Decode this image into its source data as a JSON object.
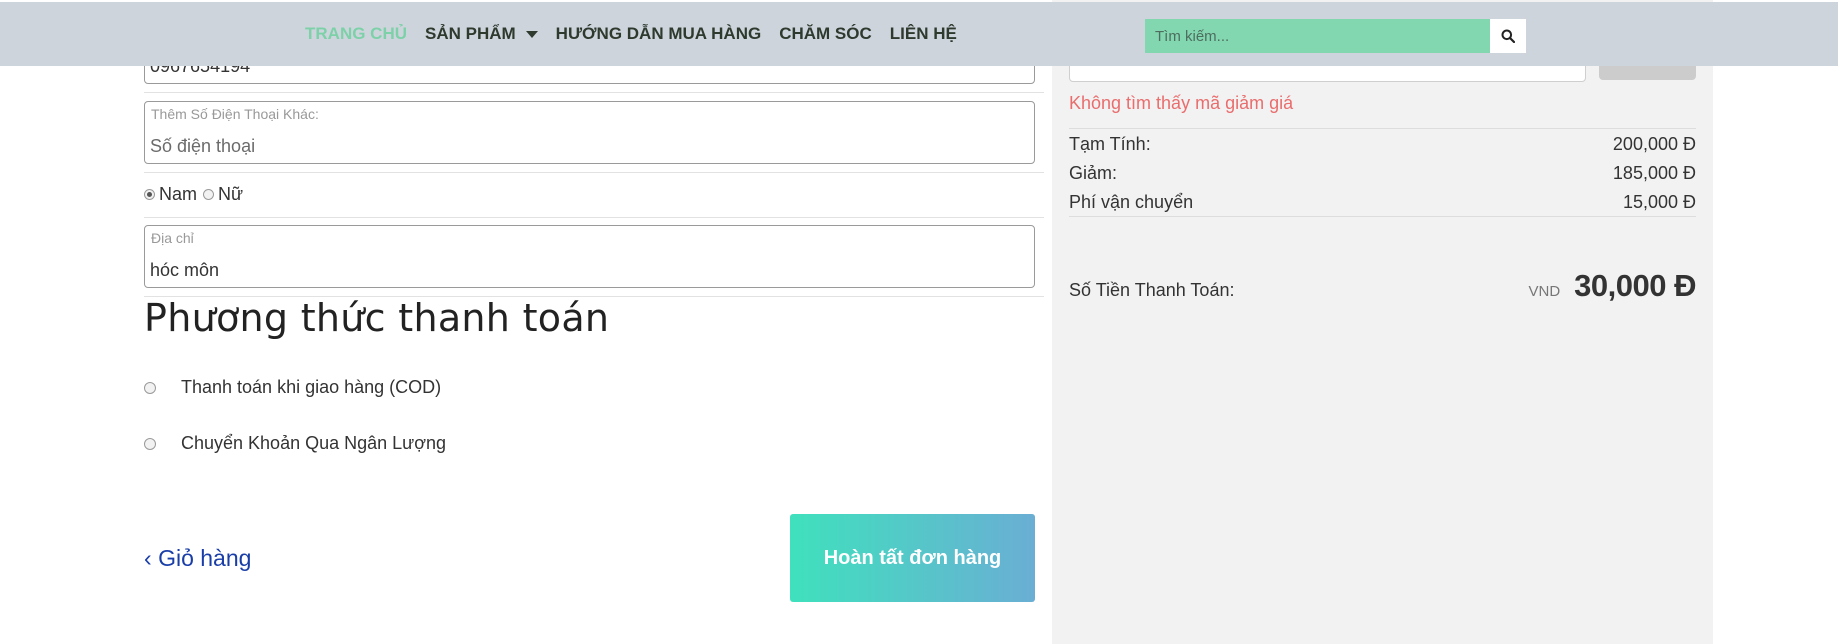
{
  "nav": {
    "items": [
      {
        "label": "TRANG CHỦ"
      },
      {
        "label": "SẢN PHẨM"
      },
      {
        "label": "HƯỚNG DẪN MUA HÀNG"
      },
      {
        "label": "CHĂM SÓC"
      },
      {
        "label": "LIÊN HỆ"
      }
    ],
    "active_index": 0,
    "search_placeholder": "Tìm kiếm...",
    "search_icon": "search-icon"
  },
  "form": {
    "phone_value": "0967654194",
    "extra_phone_label": "Thêm Số Điện Thoại Khác:",
    "extra_phone_placeholder": "Số điện thoại",
    "gender": {
      "male": "Nam",
      "female": "Nữ",
      "selected": "Nam"
    },
    "address_label": "Địa chỉ",
    "address_value": "hóc môn"
  },
  "payment": {
    "title": "Phương thức thanh toán",
    "options": [
      {
        "label": "Thanh toán khi giao hàng (COD)"
      },
      {
        "label": "Chuyển Khoản Qua Ngân Lượng"
      }
    ]
  },
  "actions": {
    "back_label": "Giỏ hàng",
    "back_icon": "chevron-left-icon",
    "complete_label": "Hoàn tất đơn hàng"
  },
  "summary": {
    "coupon_error": "Không tìm thấy mã giảm giá",
    "rows": [
      {
        "label": "Tạm Tính:",
        "value": "200,000 Đ"
      },
      {
        "label": "Giảm:",
        "value": "185,000 Đ"
      },
      {
        "label": "Phí vận chuyển",
        "value": "15,000 Đ"
      }
    ],
    "total_label": "Số Tiền Thanh Toán:",
    "currency": "VND",
    "total_value": "30,000 Đ"
  },
  "colors": {
    "nav_bg": "#ced4dc",
    "nav_active": "#7dd1a9",
    "search_bg": "#82d7b1",
    "error": "#ea6d6d",
    "link": "#1a3ea8",
    "button_gradient_start": "#3fe1bd",
    "button_gradient_end": "#6aaed4"
  }
}
